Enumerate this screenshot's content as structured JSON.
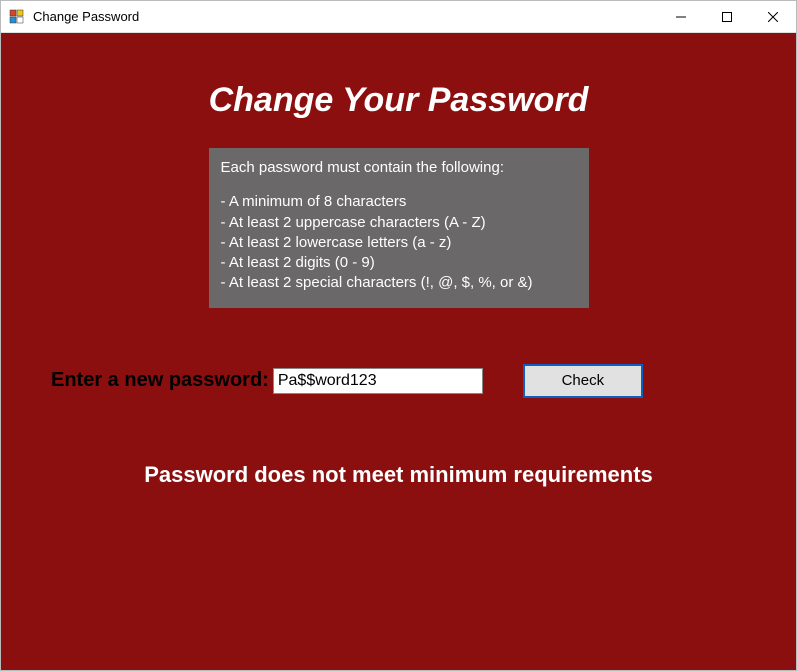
{
  "window": {
    "title": "Change Password"
  },
  "heading": "Change Your Password",
  "rules": {
    "intro": "Each password must contain the following:",
    "lines": [
      "- A minimum of 8 characters",
      "- At least 2 uppercase characters (A - Z)",
      "- At least 2 lowercase letters (a - z)",
      "- At least 2 digits (0 - 9)",
      "- At least 2 special characters (!, @, $, %, or &)"
    ]
  },
  "form": {
    "label": "Enter a new password:",
    "value": "Pa$$word123",
    "check_label": "Check"
  },
  "status": "Password does not meet minimum requirements"
}
